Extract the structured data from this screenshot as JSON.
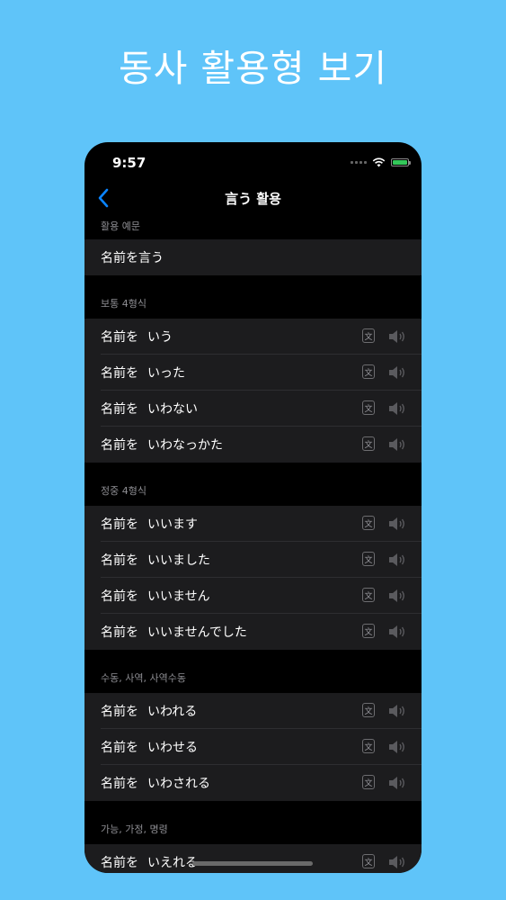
{
  "promo": {
    "title": "동사 활용형 보기"
  },
  "status_bar": {
    "time": "9:57"
  },
  "nav": {
    "back_icon": "chevron-left-icon",
    "title": "言う 활용"
  },
  "sections": [
    {
      "header": "활용 예문",
      "rows": [
        {
          "text": "名前を言う"
        }
      ]
    },
    {
      "header": "보통 4형식",
      "rows": [
        {
          "prefix": "名前を",
          "form": "いう"
        },
        {
          "prefix": "名前を",
          "form": "いった"
        },
        {
          "prefix": "名前を",
          "form": "いわない"
        },
        {
          "prefix": "名前を",
          "form": "いわなっかた"
        }
      ]
    },
    {
      "header": "정중 4형식",
      "rows": [
        {
          "prefix": "名前を",
          "form": "いいます"
        },
        {
          "prefix": "名前を",
          "form": "いいました"
        },
        {
          "prefix": "名前を",
          "form": "いいません"
        },
        {
          "prefix": "名前を",
          "form": "いいませんでした"
        }
      ]
    },
    {
      "header": "수동, 사역, 사역수동",
      "rows": [
        {
          "prefix": "名前を",
          "form": "いわれる"
        },
        {
          "prefix": "名前を",
          "form": "いわせる"
        },
        {
          "prefix": "名前を",
          "form": "いわされる"
        }
      ]
    },
    {
      "header": "가능, 가정, 명령",
      "rows": [
        {
          "prefix": "名前を",
          "form": "いえれる"
        }
      ]
    }
  ],
  "row_icons": {
    "translate_label": "文",
    "translate_icon": "translate-icon",
    "audio_icon": "speaker-icon"
  },
  "colors": {
    "background": "#5fc4f9",
    "accent": "#0a84ff",
    "cell": "#1c1c1e",
    "battery": "#33c759"
  }
}
